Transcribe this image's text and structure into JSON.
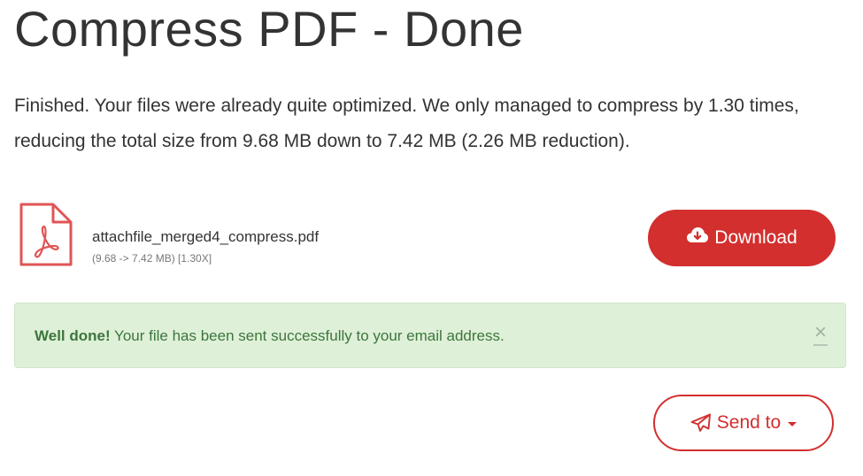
{
  "page": {
    "title": "Compress PDF - Done",
    "summary": "Finished. Your files were already quite optimized. We only managed to compress by 1.30 times, reducing the total size from 9.68 MB down to 7.42 MB (2.26 MB reduction)."
  },
  "file": {
    "icon": "pdf-file-icon",
    "name": "attachfile_merged4_compress.pdf",
    "meta": "(9.68 -> 7.42 MB) [1.30X]"
  },
  "download": {
    "label": "Download",
    "icon": "cloud-download-icon"
  },
  "alert": {
    "strong": "Well done!",
    "message": " Your file has been sent successfully to your email address.",
    "close": "×"
  },
  "send": {
    "label": "Send to",
    "icon": "paper-plane-icon"
  },
  "colors": {
    "accent": "#d32f2f",
    "success_bg": "#dff0d8",
    "success_text": "#3c763d"
  }
}
